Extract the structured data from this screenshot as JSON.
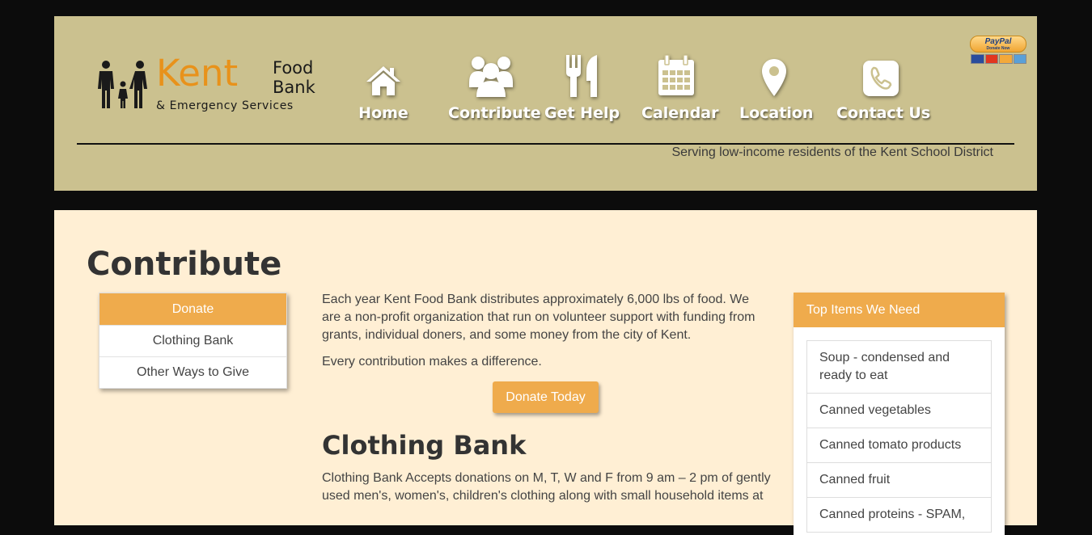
{
  "header": {
    "logo": {
      "word_kent": "Kent",
      "word_food": "Food",
      "word_bank": "Bank",
      "subtitle": "& Emergency Services"
    },
    "nav": [
      {
        "label": "Home",
        "icon": "home-icon"
      },
      {
        "label": "Contribute",
        "icon": "users-icon"
      },
      {
        "label": "Get Help",
        "icon": "fork-knife-icon"
      },
      {
        "label": "Calendar",
        "icon": "calendar-icon"
      },
      {
        "label": "Location",
        "icon": "map-pin-icon"
      },
      {
        "label": "Contact Us",
        "icon": "phone-icon"
      }
    ],
    "tagline": "Serving low-income residents of the Kent School District",
    "paypal": {
      "brand": "PayPal",
      "action": "Donate Now"
    }
  },
  "content": {
    "title": "Contribute",
    "side_menu": [
      {
        "label": "Donate",
        "active": true
      },
      {
        "label": "Clothing Bank",
        "active": false
      },
      {
        "label": "Other Ways to Give",
        "active": false
      }
    ],
    "intro_paragraph": "Each year Kent Food Bank distributes approximately 6,000 lbs of food. We are a non-profit organization that run on volunteer support with funding from grants, individual doners, and some money from the city of Kent.",
    "difference_paragraph": "Every contribution makes a difference.",
    "donate_button": "Donate Today",
    "clothing_title": "Clothing Bank",
    "clothing_paragraph": "Clothing Bank Accepts donations on M, T, W and F from 9 am – 2 pm of gently used men's, women's, children's clothing along with small household items at",
    "needs_panel": {
      "title": "Top Items We Need",
      "items": [
        "Soup - condensed and ready to eat",
        "Canned vegetables",
        "Canned tomato products",
        "Canned fruit",
        "Canned proteins - SPAM,"
      ]
    }
  },
  "colors": {
    "header_bg": "#cbc18f",
    "content_bg": "#ffefd4",
    "accent": "#efab4c",
    "logo_orange": "#e8921b"
  }
}
